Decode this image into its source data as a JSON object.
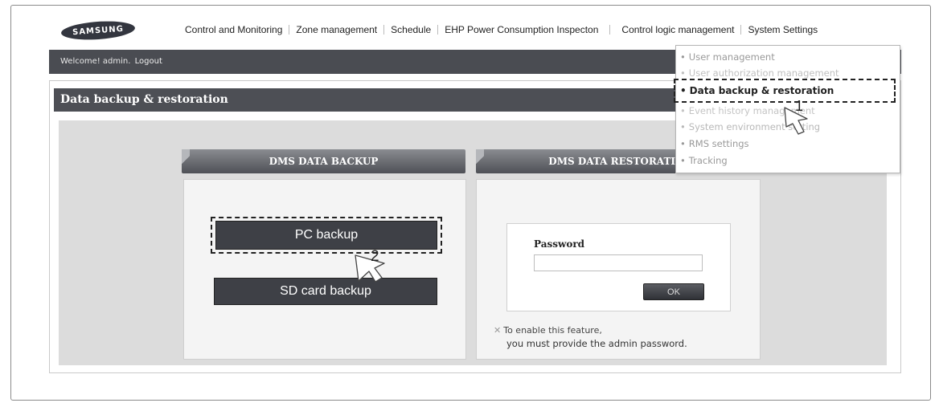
{
  "brand": {
    "logo_text": "SAMSUNG"
  },
  "topnav": {
    "items": [
      "Control and Monitoring",
      "Zone management",
      "Schedule",
      "EHP Power Consumption Inspecton",
      "Control logic management",
      "System Settings"
    ]
  },
  "welcome_bar": {
    "welcome_text": "Welcome! admin.",
    "logout_label": "Logout"
  },
  "page": {
    "title": "Data backup & restoration"
  },
  "backup_panel": {
    "header": "DMS DATA BACKUP",
    "pc_backup_label": "PC backup",
    "sd_backup_label": "SD card backup"
  },
  "restore_panel": {
    "header": "DMS DATA RESTORATI",
    "password_label": "Password",
    "password_value": "",
    "ok_label": "OK",
    "note_mark": "✕",
    "note_line1": "To enable this feature,",
    "note_line2": "you must provide the admin password."
  },
  "system_settings_menu": {
    "items": [
      "User management",
      "User authorization management",
      "Data backup & restoration",
      "Event history management",
      "System environment setting",
      "RMS settings",
      "Tracking"
    ],
    "active_index": 2
  },
  "callouts": {
    "step1": "1",
    "step2": "2"
  }
}
